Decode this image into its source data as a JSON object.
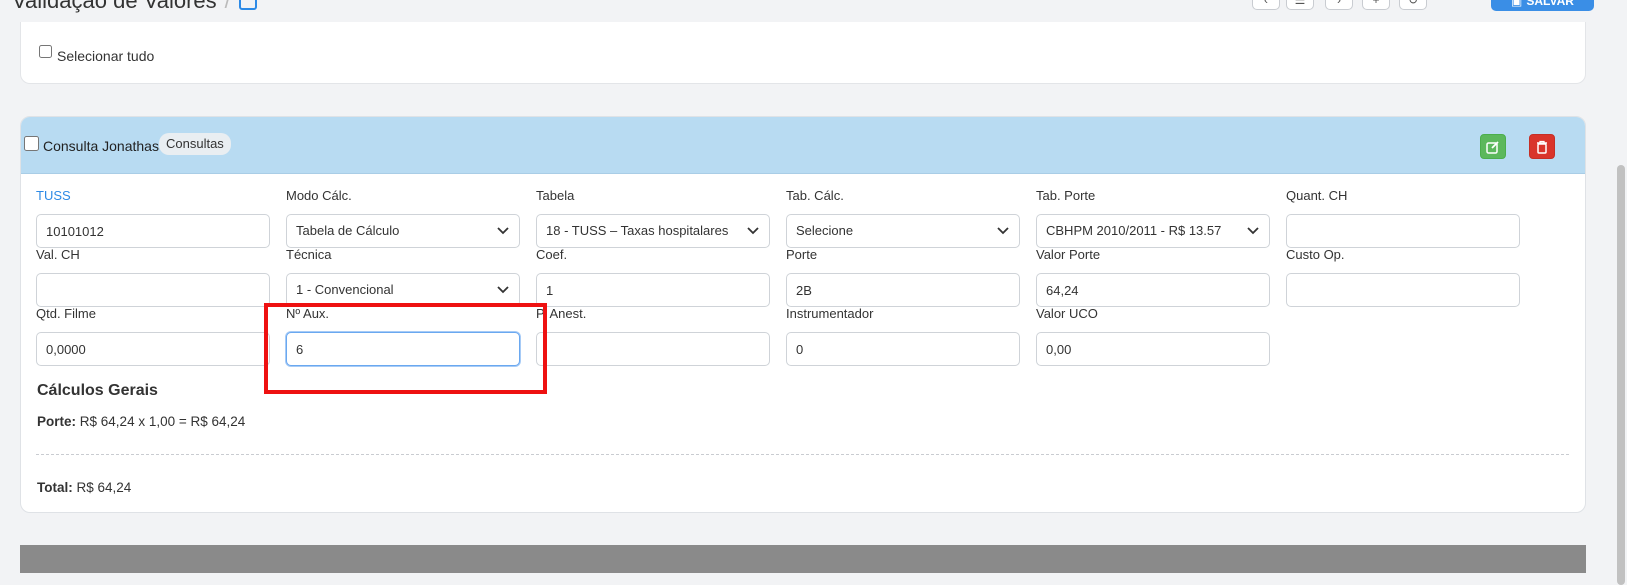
{
  "header": {
    "title": "Validação de Valores",
    "save_label": "SALVAR",
    "accent_color": "#3a8ee6"
  },
  "select_all": {
    "label": "Selecionar tudo",
    "checked": false
  },
  "procedure": {
    "name": "Consulta Jonathas",
    "badge": "Consultas",
    "checked": false,
    "header_color": "#b8dbf2"
  },
  "fields": {
    "tuss": {
      "label": "TUSS",
      "value": "10101012"
    },
    "modo_calc": {
      "label": "Modo Cálc.",
      "value": "Tabela de Cálculo"
    },
    "tabela": {
      "label": "Tabela",
      "value": "18 - TUSS – Taxas hospitalares"
    },
    "tab_calc": {
      "label": "Tab. Cálc.",
      "value": "Selecione"
    },
    "tab_porte": {
      "label": "Tab. Porte",
      "value": "CBHPM 2010/2011 - R$ 13.57"
    },
    "quant_ch": {
      "label": "Quant. CH",
      "value": ""
    },
    "val_ch": {
      "label": "Val. CH",
      "value": ""
    },
    "tecnica": {
      "label": "Técnica",
      "value": "1 - Convencional"
    },
    "coef": {
      "label": "Coef.",
      "value": "1"
    },
    "porte": {
      "label": "Porte",
      "value": "2B"
    },
    "valor_porte": {
      "label": "Valor Porte",
      "value": "64,24"
    },
    "custo_op": {
      "label": "Custo Op.",
      "value": ""
    },
    "qtd_filme": {
      "label": "Qtd. Filme",
      "value": "0,0000"
    },
    "n_aux": {
      "label": "Nº Aux.",
      "value": "6"
    },
    "p_anest": {
      "label": "P. Anest.",
      "value": ""
    },
    "instrumentador": {
      "label": "Instrumentador",
      "value": "0"
    },
    "valor_uco": {
      "label": "Valor UCO",
      "value": "0,00"
    }
  },
  "calculos": {
    "title": "Cálculos Gerais",
    "porte_label": "Porte:",
    "porte_formula": "R$ 64,24 x 1,00 = R$ 64,24",
    "total_label": "Total:",
    "total_value": "R$ 64,24"
  },
  "icons": {
    "edit": "edit-icon",
    "delete": "trash-icon",
    "dropdown": "chevron-down-icon"
  }
}
